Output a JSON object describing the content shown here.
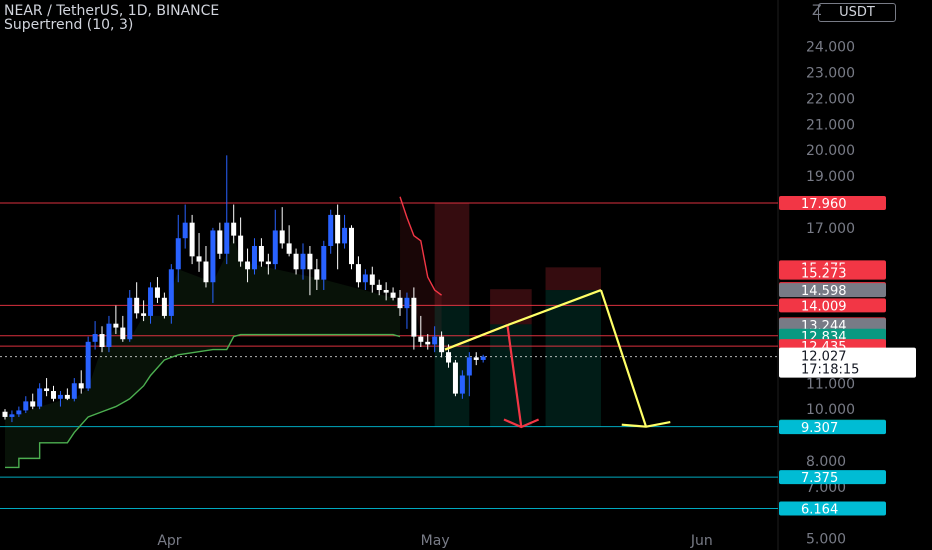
{
  "header": {
    "title": "NEAR / TetherUS, 1D, BINANCE",
    "indicator": "Supertrend (10, 3)",
    "currency": "USDT",
    "top_axis_label": "Z"
  },
  "chart_data": {
    "type": "candlestick",
    "ylim": [
      5.0,
      25.0
    ],
    "y_ticks": [
      {
        "value": 24,
        "label": "24.000"
      },
      {
        "value": 23,
        "label": "23.000"
      },
      {
        "value": 22,
        "label": "22.000"
      },
      {
        "value": 21,
        "label": "21.000"
      },
      {
        "value": 20,
        "label": "20.000"
      },
      {
        "value": 19,
        "label": "19.000"
      },
      {
        "value": 17,
        "label": "17.000"
      },
      {
        "value": 11,
        "label": "11.000"
      },
      {
        "value": 10,
        "label": "10.000"
      },
      {
        "value": 8,
        "label": "8.000"
      },
      {
        "value": 7,
        "label": "7.000"
      },
      {
        "value": 5,
        "label": "5.000"
      }
    ],
    "x_ticks": [
      {
        "index": 24,
        "label": "Apr"
      },
      {
        "index": 62,
        "label": "May"
      },
      {
        "index": 101,
        "label": "Jun"
      }
    ],
    "candles": [
      [
        9.9,
        10.0,
        9.6,
        9.7
      ],
      [
        9.7,
        9.95,
        9.5,
        9.8
      ],
      [
        9.8,
        10.1,
        9.7,
        9.95
      ],
      [
        9.95,
        10.5,
        9.85,
        10.3
      ],
      [
        10.3,
        10.6,
        10.0,
        10.1
      ],
      [
        10.1,
        11.0,
        10.0,
        10.8
      ],
      [
        10.8,
        11.2,
        10.5,
        10.7
      ],
      [
        10.7,
        10.9,
        10.3,
        10.4
      ],
      [
        10.4,
        10.7,
        10.1,
        10.55
      ],
      [
        10.55,
        10.8,
        10.35,
        10.4
      ],
      [
        10.4,
        11.2,
        10.3,
        11.0
      ],
      [
        11.0,
        11.5,
        10.6,
        10.8
      ],
      [
        10.8,
        12.8,
        10.7,
        12.6
      ],
      [
        12.6,
        13.4,
        12.3,
        12.9
      ],
      [
        12.9,
        13.2,
        12.2,
        12.4
      ],
      [
        12.4,
        13.6,
        12.2,
        13.3
      ],
      [
        13.3,
        14.0,
        12.9,
        13.15
      ],
      [
        13.15,
        13.6,
        12.6,
        12.7
      ],
      [
        12.7,
        14.6,
        12.6,
        14.3
      ],
      [
        14.3,
        14.9,
        13.5,
        13.7
      ],
      [
        13.7,
        14.2,
        13.4,
        13.6
      ],
      [
        13.6,
        14.9,
        13.3,
        14.7
      ],
      [
        14.7,
        15.1,
        14.1,
        14.3
      ],
      [
        14.3,
        14.5,
        13.5,
        13.6
      ],
      [
        13.6,
        15.6,
        13.3,
        15.4
      ],
      [
        15.4,
        17.5,
        14.9,
        16.6
      ],
      [
        16.6,
        17.9,
        16.2,
        17.2
      ],
      [
        17.2,
        17.5,
        15.6,
        15.9
      ],
      [
        15.9,
        16.8,
        15.3,
        15.7
      ],
      [
        15.7,
        16.3,
        14.7,
        14.9
      ],
      [
        14.9,
        17.0,
        14.1,
        16.9
      ],
      [
        16.9,
        17.2,
        15.8,
        16.0
      ],
      [
        16.0,
        19.8,
        15.6,
        17.2
      ],
      [
        17.2,
        17.9,
        16.4,
        16.7
      ],
      [
        16.7,
        17.4,
        15.5,
        15.7
      ],
      [
        15.7,
        16.2,
        14.9,
        15.4
      ],
      [
        15.4,
        16.6,
        15.2,
        16.3
      ],
      [
        16.3,
        16.6,
        15.5,
        15.7
      ],
      [
        15.7,
        16.0,
        15.2,
        15.6
      ],
      [
        15.6,
        17.7,
        15.4,
        16.9
      ],
      [
        16.9,
        17.8,
        16.2,
        16.4
      ],
      [
        16.4,
        17.1,
        15.9,
        16.0
      ],
      [
        16.0,
        16.2,
        15.2,
        15.4
      ],
      [
        15.4,
        16.4,
        15.0,
        16.0
      ],
      [
        16.0,
        16.3,
        14.4,
        15.4
      ],
      [
        15.4,
        15.8,
        14.6,
        15.0
      ],
      [
        15.0,
        16.5,
        14.6,
        16.3
      ],
      [
        16.3,
        17.7,
        16.0,
        17.5
      ],
      [
        17.5,
        17.9,
        15.4,
        16.4
      ],
      [
        16.4,
        17.5,
        16.2,
        17.0
      ],
      [
        17.0,
        17.1,
        15.4,
        15.6
      ],
      [
        15.6,
        15.9,
        14.7,
        14.9
      ],
      [
        14.9,
        15.4,
        14.6,
        15.2
      ],
      [
        15.2,
        15.5,
        14.5,
        14.8
      ],
      [
        14.8,
        15.0,
        14.4,
        14.6
      ],
      [
        14.6,
        14.9,
        14.2,
        14.5
      ],
      [
        14.5,
        14.7,
        14.2,
        14.3
      ],
      [
        14.3,
        14.6,
        13.6,
        13.9
      ],
      [
        13.9,
        14.5,
        13.1,
        14.3
      ],
      [
        14.3,
        14.7,
        12.3,
        12.8
      ],
      [
        12.8,
        13.6,
        12.4,
        12.6
      ],
      [
        12.6,
        12.9,
        12.3,
        12.5
      ],
      [
        12.5,
        13.2,
        12.2,
        12.8
      ],
      [
        12.8,
        13.0,
        12.0,
        12.2
      ],
      [
        12.2,
        12.5,
        11.6,
        11.8
      ],
      [
        11.8,
        11.9,
        10.5,
        10.6
      ],
      [
        10.6,
        11.5,
        10.4,
        11.3
      ],
      [
        11.3,
        12.2,
        10.5,
        12.0
      ],
      [
        12.0,
        12.2,
        11.7,
        11.9
      ],
      [
        11.9,
        12.1,
        11.8,
        12.03
      ]
    ],
    "supertrend_up": [
      [
        0,
        7.75
      ],
      [
        2,
        7.75
      ],
      [
        2,
        8.1
      ],
      [
        5,
        8.1
      ],
      [
        5,
        8.7
      ],
      [
        9,
        8.7
      ],
      [
        10,
        9.1
      ],
      [
        12,
        9.7
      ],
      [
        14,
        9.9
      ],
      [
        16,
        10.1
      ],
      [
        18,
        10.4
      ],
      [
        20,
        10.9
      ],
      [
        21,
        11.3
      ],
      [
        23,
        11.9
      ],
      [
        25,
        12.1
      ],
      [
        30,
        12.3
      ],
      [
        32,
        12.3
      ],
      [
        33,
        12.8
      ],
      [
        34,
        12.88
      ],
      [
        46,
        12.88
      ],
      [
        56,
        12.88
      ],
      [
        57,
        12.8
      ]
    ],
    "supertrend_down": [
      [
        57,
        18.2
      ],
      [
        58,
        17.4
      ],
      [
        59,
        16.7
      ],
      [
        60,
        16.5
      ],
      [
        61,
        15.1
      ],
      [
        62,
        14.6
      ],
      [
        63,
        14.4
      ]
    ],
    "h_lines": [
      {
        "value": 17.96,
        "color": "#f23645"
      },
      {
        "value": 14.009,
        "color": "#f23645"
      },
      {
        "value": 12.834,
        "color": "#f23645"
      },
      {
        "value": 12.435,
        "color": "#f23645"
      },
      {
        "value": 9.324,
        "color": "#00bcd4"
      },
      {
        "value": 7.375,
        "color": "#00bcd4"
      },
      {
        "value": 6.164,
        "color": "#00bcd4"
      }
    ],
    "current_price": {
      "value": 12.027,
      "label": "12.027",
      "countdown": "17:18:15"
    },
    "price_labels": [
      {
        "value": 17.96,
        "label": "17.960",
        "bg": "#f23645"
      },
      {
        "value": 15.475,
        "label": "15.475",
        "bg": "#f23645"
      },
      {
        "value": 15.273,
        "label": "15.273",
        "bg": "#f23645"
      },
      {
        "value": 14.632,
        "label": "14.632",
        "bg": "#f23645"
      },
      {
        "value": 14.598,
        "label": "14.598",
        "bg": "#787b86"
      },
      {
        "value": 14.009,
        "label": "14.009",
        "bg": "#f23645"
      },
      {
        "value": 13.275,
        "label": "13.275",
        "bg": "#f23645"
      },
      {
        "value": 13.244,
        "label": "13.244",
        "bg": "#787b86"
      },
      {
        "value": 12.834,
        "label": "12.834",
        "bg": "#089981"
      },
      {
        "value": 12.435,
        "label": "12.435",
        "bg": "#f23645"
      },
      {
        "value": 9.324,
        "label": "9.324",
        "bg": "#089981"
      },
      {
        "value": 9.311,
        "label": "9.311",
        "bg": "#089981"
      },
      {
        "value": 9.307,
        "label": "9.307",
        "bg": "#00bcd4"
      },
      {
        "value": 7.375,
        "label": "7.375",
        "bg": "#00bcd4"
      },
      {
        "value": 6.164,
        "label": "6.164",
        "bg": "#00bcd4"
      }
    ],
    "positions": [
      {
        "x_start": 62,
        "x_end": 67,
        "entry": 14.009,
        "stop": 17.96,
        "target": 9.311
      },
      {
        "x_start": 70,
        "x_end": 76,
        "entry": 13.275,
        "stop": 14.632,
        "target": 9.311
      },
      {
        "x_start": 78,
        "x_end": 86,
        "entry": 14.598,
        "stop": 15.475,
        "target": 9.324
      }
    ],
    "drawings": [
      {
        "color": "#f23645",
        "points": [
          [
            63.5,
            12.3
          ],
          [
            72.5,
            13.244
          ]
        ]
      },
      {
        "color": "#f23645",
        "points": [
          [
            72.5,
            13.244
          ],
          [
            74.5,
            9.311
          ]
        ]
      },
      {
        "color": "#f23645",
        "points": [
          [
            72.0,
            9.6
          ],
          [
            74.5,
            9.311
          ],
          [
            77.0,
            9.6
          ]
        ]
      },
      {
        "color": "#ffff66",
        "points": [
          [
            63.5,
            12.3
          ],
          [
            72.5,
            13.244
          ]
        ]
      },
      {
        "color": "#ffff66",
        "points": [
          [
            72.5,
            13.244
          ],
          [
            86.0,
            14.598
          ]
        ]
      },
      {
        "color": "#ffff66",
        "points": [
          [
            86.0,
            14.598
          ],
          [
            92.5,
            9.324
          ]
        ]
      },
      {
        "color": "#ffff66",
        "points": [
          [
            89.0,
            9.4
          ],
          [
            92.5,
            9.324
          ],
          [
            96.0,
            9.5
          ]
        ]
      }
    ],
    "colors": {
      "bull": "#2962ff",
      "bear": "#ffffff",
      "supertrend_up": "#4caf50",
      "supertrend_down": "#f23645",
      "up_fill": "rgba(76,175,80,0.10)",
      "down_fill": "rgba(242,54,69,0.10)",
      "profit_zone": "rgba(8,153,129,0.18)",
      "loss_zone": "rgba(242,54,69,0.22)"
    }
  }
}
